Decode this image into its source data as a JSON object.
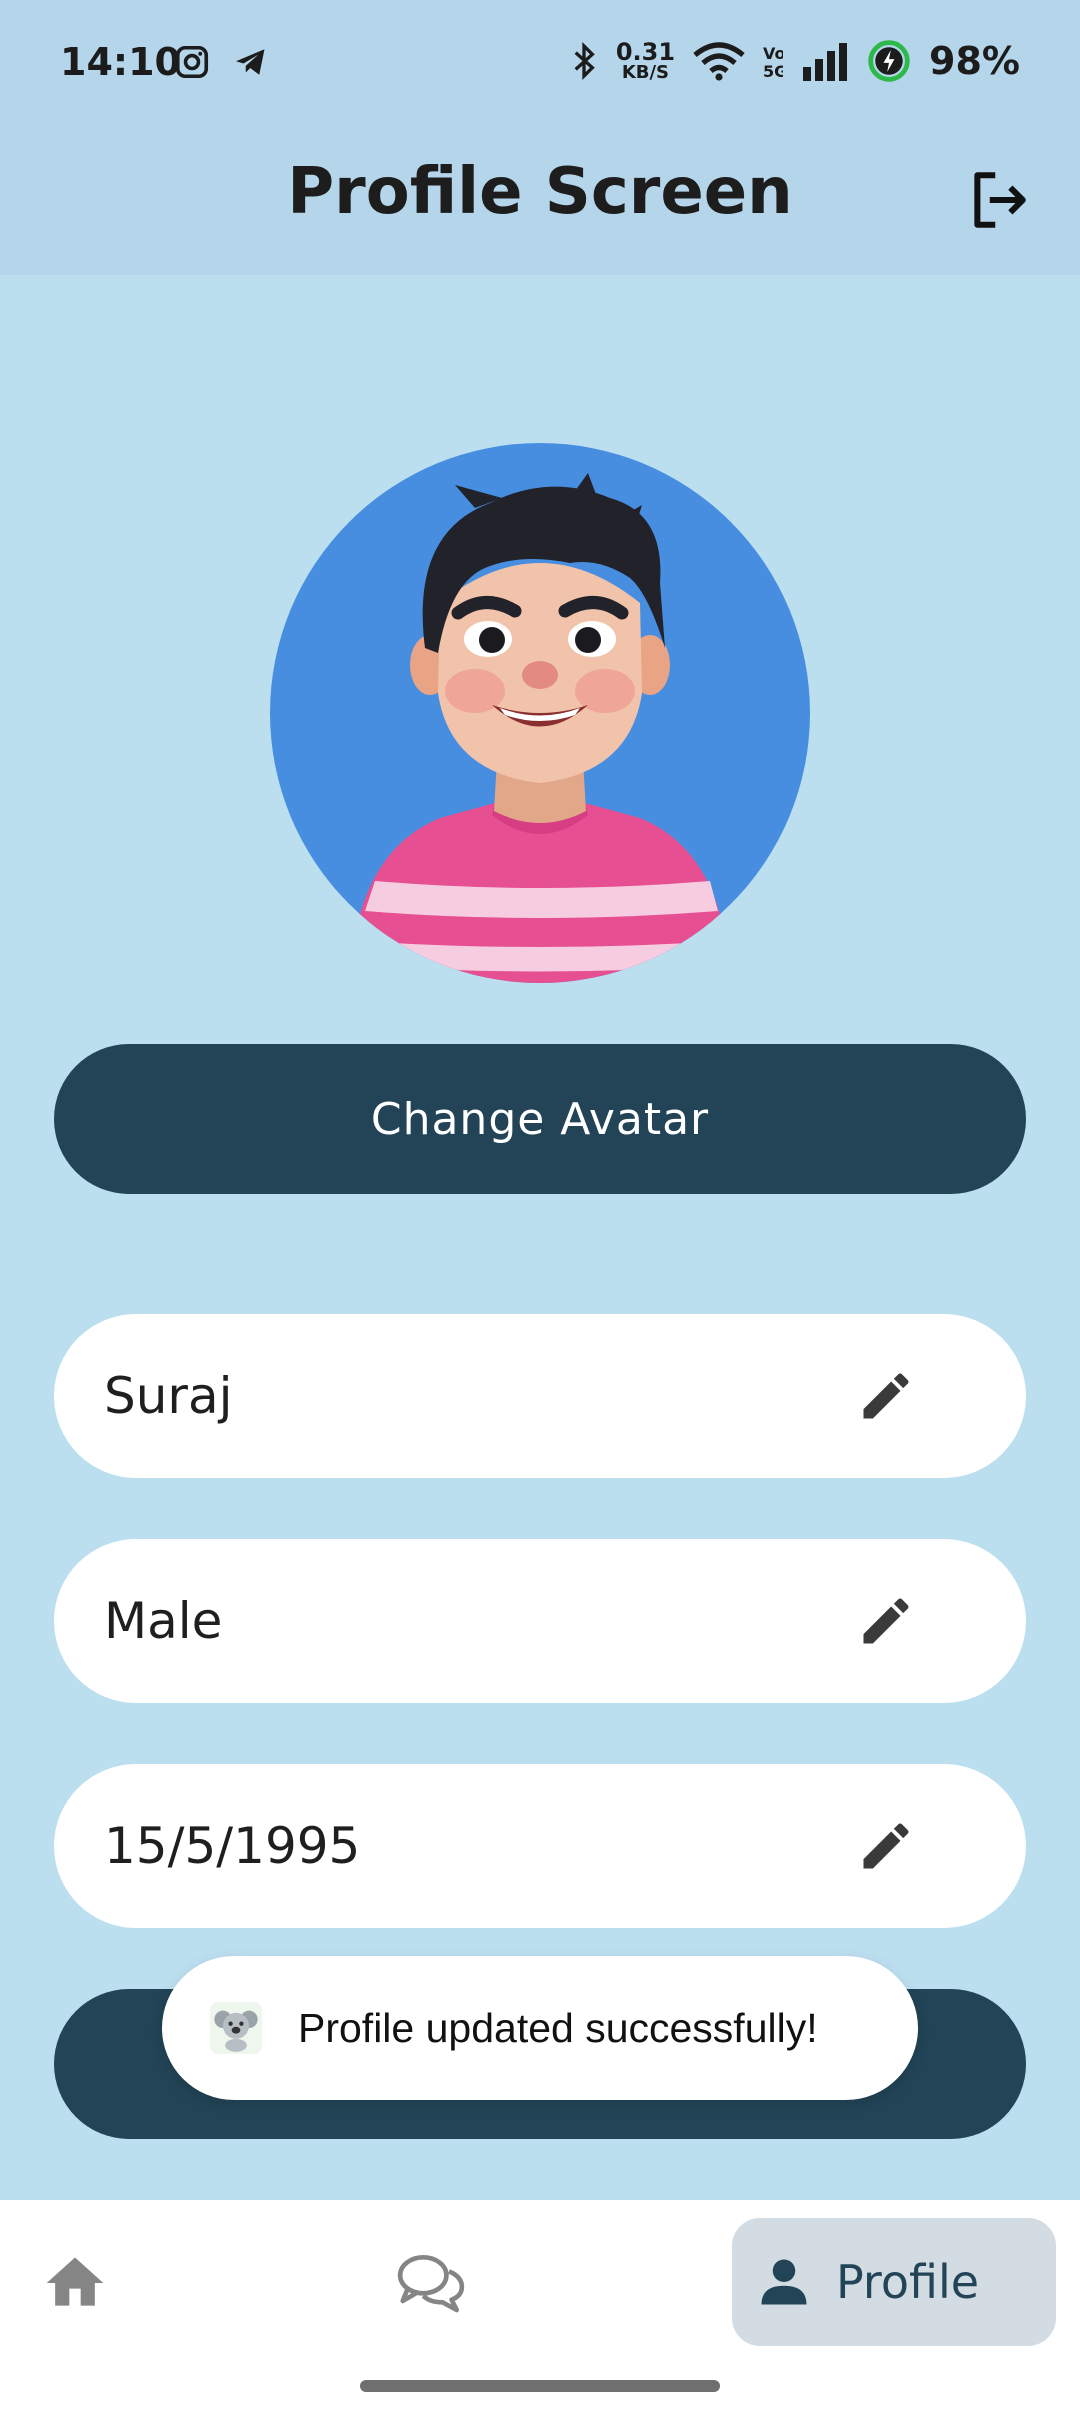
{
  "status_bar": {
    "time": "14:10",
    "net_speed_value": "0.31",
    "net_speed_unit": "KB/S",
    "battery": "98%",
    "icons": [
      "instagram-icon",
      "telegram-icon",
      "bluetooth-icon",
      "wifi-icon",
      "volte-icon",
      "signal-icon",
      "battery-charging-icon"
    ]
  },
  "header": {
    "title": "Profile Screen",
    "logout_icon": "logout-icon"
  },
  "profile": {
    "change_avatar_label": "Change Avatar",
    "fields": [
      {
        "value": "Suraj",
        "icon": "edit-icon"
      },
      {
        "value": "Male",
        "icon": "edit-icon"
      },
      {
        "value": "15/5/1995",
        "icon": "edit-icon"
      }
    ]
  },
  "toast": {
    "message": "Profile updated successfully!",
    "icon": "app-koala-icon"
  },
  "bottom_nav": {
    "items": [
      {
        "icon": "home-icon"
      },
      {
        "icon": "chat-icon"
      },
      {
        "icon": "person-icon",
        "label": "Profile",
        "active": true
      }
    ]
  },
  "colors": {
    "background": "#bcdff0",
    "header": "#b5d6ea",
    "primary": "#224456",
    "avatar_bg": "#478ee0",
    "shirt": "#e64f91"
  }
}
